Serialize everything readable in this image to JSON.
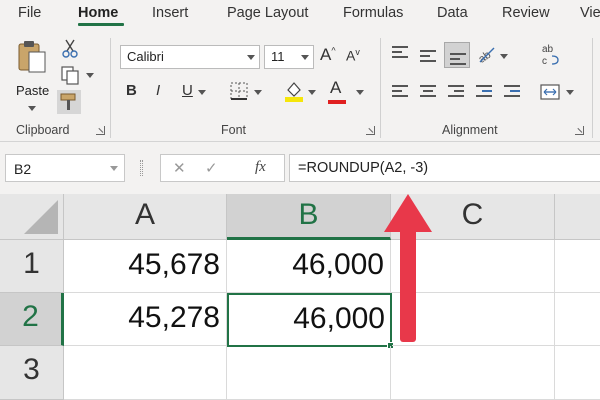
{
  "menu": {
    "tabs": [
      {
        "label": "File"
      },
      {
        "label": "Home",
        "active": true
      },
      {
        "label": "Insert"
      },
      {
        "label": "Page Layout"
      },
      {
        "label": "Formulas"
      },
      {
        "label": "Data"
      },
      {
        "label": "Review"
      },
      {
        "label": "Vie"
      }
    ]
  },
  "ribbon": {
    "clipboard": {
      "label": "Clipboard",
      "paste_label": "Paste"
    },
    "font": {
      "label": "Font",
      "font_name": "Calibri",
      "font_size": "11",
      "bold": "B",
      "italic": "I",
      "underline": "U",
      "grow": "A",
      "shrink": "A",
      "font_color_letter": "A"
    },
    "alignment": {
      "label": "Alignment"
    }
  },
  "formula_bar": {
    "name_box": "B2",
    "cancel": "✕",
    "enter": "✓",
    "fx": "fx",
    "formula": "=ROUNDUP(A2, -3)"
  },
  "sheet": {
    "columns": [
      "A",
      "B",
      "C"
    ],
    "rows": [
      "1",
      "2",
      "3"
    ],
    "cells": {
      "A1": "45,678",
      "B1": "46,000",
      "A2": "45,278",
      "B2": "46,000"
    },
    "active_cell": "B2"
  },
  "colors": {
    "accent": "#217346",
    "annotation_arrow": "#e8384a",
    "ribbon_bg": "#f3f2f1"
  }
}
